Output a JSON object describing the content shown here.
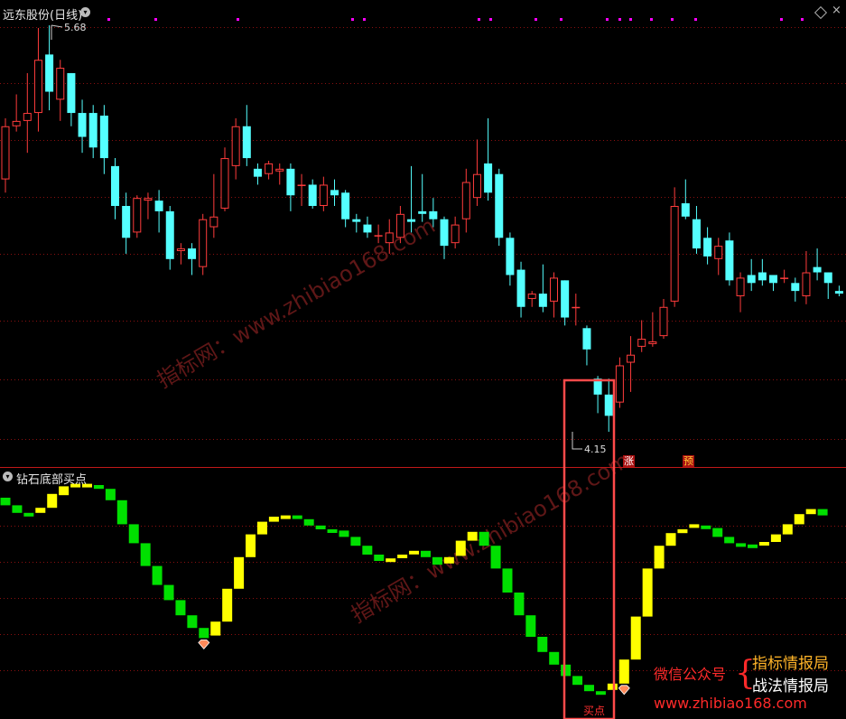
{
  "main_panel": {
    "title": "远东股份(日线)",
    "high_label": "5.68",
    "low_label": "4.15",
    "badge_zhang": "涨",
    "badge_yu": "预"
  },
  "sub_panel": {
    "title": "钻石底部买点",
    "buy_point": "买点"
  },
  "watermark": {
    "site": "指标网：www.zhibiao168.com",
    "site_2": "指标网：www.zhibiao168.com"
  },
  "promo": {
    "wechat": "微信公众号",
    "line1": "指标情报局",
    "line2": "战法情报局",
    "url": "www.zhibiao168.com"
  },
  "colors": {
    "up": "#ff3c3c",
    "down": "#54ffff",
    "grid": "#8a1010",
    "indicator_up": "#ffff00",
    "indicator_down": "#00e000",
    "highlight_box": "#ff4a4a",
    "dots": "#ff00ff"
  },
  "chart_data": [
    {
      "type": "candlestick",
      "name": "远东股份(日线)",
      "ylim": [
        4.1,
        5.75
      ],
      "candles": [
        [
          5.1,
          5.3,
          5.05,
          5.33
        ],
        [
          5.3,
          5.32,
          5.28,
          5.42
        ],
        [
          5.32,
          5.35,
          5.2,
          5.5
        ],
        [
          5.35,
          5.55,
          5.28,
          5.67
        ],
        [
          5.57,
          5.43,
          5.36,
          5.68
        ],
        [
          5.4,
          5.52,
          5.32,
          5.55
        ],
        [
          5.5,
          5.35,
          5.3,
          5.5
        ],
        [
          5.35,
          5.26,
          5.2,
          5.4
        ],
        [
          5.35,
          5.22,
          5.18,
          5.38
        ],
        [
          5.34,
          5.18,
          5.12,
          5.38
        ],
        [
          5.15,
          5.0,
          4.95,
          5.18
        ],
        [
          5.0,
          4.88,
          4.82,
          5.05
        ],
        [
          4.9,
          5.03,
          4.88,
          5.04
        ],
        [
          5.02,
          5.03,
          4.95,
          5.05
        ],
        [
          5.02,
          4.98,
          4.9,
          5.06
        ],
        [
          4.98,
          4.8,
          4.76,
          5.0
        ],
        [
          4.83,
          4.84,
          4.78,
          4.86
        ],
        [
          4.84,
          4.8,
          4.74,
          4.86
        ],
        [
          4.77,
          4.95,
          4.74,
          4.97
        ],
        [
          4.92,
          4.96,
          4.88,
          5.12
        ],
        [
          4.99,
          5.18,
          4.98,
          5.22
        ],
        [
          5.15,
          5.3,
          5.1,
          5.33
        ],
        [
          5.3,
          5.18,
          5.15,
          5.38
        ],
        [
          5.14,
          5.11,
          5.08,
          5.16
        ],
        [
          5.12,
          5.16,
          5.1,
          5.17
        ],
        [
          5.13,
          5.14,
          5.08,
          5.16
        ],
        [
          5.14,
          5.04,
          4.98,
          5.16
        ],
        [
          5.08,
          5.08,
          5.0,
          5.12
        ],
        [
          5.08,
          5.0,
          4.99,
          5.1
        ],
        [
          5.0,
          5.08,
          4.98,
          5.11
        ],
        [
          5.06,
          5.04,
          5.0,
          5.1
        ],
        [
          5.05,
          4.95,
          4.92,
          5.06
        ],
        [
          4.95,
          4.94,
          4.9,
          4.97
        ],
        [
          4.93,
          4.9,
          4.88,
          4.96
        ],
        [
          4.89,
          4.89,
          4.86,
          4.93
        ],
        [
          4.86,
          4.9,
          4.82,
          4.95
        ],
        [
          4.88,
          4.97,
          4.86,
          5.0
        ],
        [
          4.95,
          4.94,
          4.9,
          5.15
        ],
        [
          4.98,
          4.97,
          4.94,
          5.12
        ],
        [
          4.98,
          4.95,
          4.92,
          5.03
        ],
        [
          4.95,
          4.85,
          4.8,
          4.96
        ],
        [
          4.86,
          4.93,
          4.84,
          4.96
        ],
        [
          4.95,
          5.09,
          4.9,
          5.14
        ],
        [
          5.03,
          5.12,
          5.0,
          5.25
        ],
        [
          5.16,
          5.05,
          5.02,
          5.33
        ],
        [
          5.12,
          4.88,
          4.85,
          5.14
        ],
        [
          4.88,
          4.74,
          4.7,
          4.9
        ],
        [
          4.76,
          4.62,
          4.58,
          4.79
        ],
        [
          4.65,
          4.67,
          4.62,
          4.68
        ],
        [
          4.67,
          4.62,
          4.6,
          4.78
        ],
        [
          4.64,
          4.73,
          4.58,
          4.75
        ],
        [
          4.72,
          4.58,
          4.55,
          4.72
        ],
        [
          4.62,
          4.62,
          4.55,
          4.67
        ],
        [
          4.54,
          4.46,
          4.4,
          4.55
        ],
        [
          4.35,
          4.29,
          4.22,
          4.36
        ],
        [
          4.29,
          4.21,
          4.15,
          4.35
        ],
        [
          4.26,
          4.4,
          4.24,
          4.43
        ],
        [
          4.41,
          4.44,
          4.3,
          4.51
        ],
        [
          4.47,
          4.5,
          4.45,
          4.57
        ],
        [
          4.48,
          4.49,
          4.47,
          4.6
        ],
        [
          4.51,
          4.62,
          4.5,
          4.65
        ],
        [
          4.64,
          5.0,
          4.62,
          5.07
        ],
        [
          5.01,
          4.96,
          4.95,
          5.1
        ],
        [
          4.95,
          4.84,
          4.82,
          5.0
        ],
        [
          4.88,
          4.81,
          4.78,
          4.92
        ],
        [
          4.8,
          4.85,
          4.74,
          4.88
        ],
        [
          4.87,
          4.72,
          4.7,
          4.9
        ],
        [
          4.66,
          4.73,
          4.6,
          4.75
        ],
        [
          4.74,
          4.71,
          4.68,
          4.8
        ],
        [
          4.75,
          4.72,
          4.7,
          4.8
        ],
        [
          4.74,
          4.71,
          4.68,
          4.73
        ],
        [
          4.73,
          4.73,
          4.71,
          4.76
        ],
        [
          4.71,
          4.68,
          4.64,
          4.73
        ],
        [
          4.66,
          4.75,
          4.63,
          4.83
        ],
        [
          4.77,
          4.75,
          4.72,
          4.84
        ],
        [
          4.75,
          4.71,
          4.65,
          4.75
        ],
        [
          4.68,
          4.67,
          4.66,
          4.7
        ],
        [
          4.69,
          4.6,
          4.56,
          4.69
        ]
      ]
    },
    {
      "type": "bar",
      "name": "钻石底部买点",
      "ylim": [
        0,
        100
      ],
      "markers": [
        17,
        53
      ],
      "segments": [
        [
          80,
          74,
          0
        ],
        [
          74,
          68,
          0
        ],
        [
          68,
          67,
          0
        ],
        [
          68,
          72,
          1
        ],
        [
          72,
          83,
          1
        ],
        [
          82,
          89,
          1
        ],
        [
          89,
          91,
          1
        ],
        [
          91,
          91,
          1
        ],
        [
          90,
          87,
          0
        ],
        [
          87,
          78,
          0
        ],
        [
          78,
          59,
          0
        ],
        [
          59,
          44,
          0
        ],
        [
          44,
          26,
          0
        ],
        [
          26,
          11,
          0
        ],
        [
          11,
          -1,
          0
        ],
        [
          -1,
          -13,
          0
        ],
        [
          -13,
          -23,
          0
        ],
        [
          -23,
          -31,
          0
        ],
        [
          -29,
          -18,
          1
        ],
        [
          -18,
          8,
          1
        ],
        [
          8,
          33,
          1
        ],
        [
          33,
          51,
          1
        ],
        [
          51,
          61,
          1
        ],
        [
          61,
          65,
          1
        ],
        [
          65,
          66,
          1
        ],
        [
          66,
          64,
          0
        ],
        [
          63,
          58,
          0
        ],
        [
          58,
          55,
          0
        ],
        [
          55,
          54,
          0
        ],
        [
          54,
          49,
          0
        ],
        [
          49,
          42,
          0
        ],
        [
          42,
          35,
          0
        ],
        [
          35,
          30,
          0
        ],
        [
          31,
          32,
          1
        ],
        [
          33,
          35,
          1
        ],
        [
          36,
          38,
          1
        ],
        [
          38,
          33,
          0
        ],
        [
          33,
          27,
          0
        ],
        [
          28,
          33,
          1
        ],
        [
          34,
          46,
          1
        ],
        [
          46,
          53,
          1
        ],
        [
          53,
          42,
          0
        ],
        [
          42,
          24,
          0
        ],
        [
          24,
          5,
          0
        ],
        [
          5,
          -13,
          0
        ],
        [
          -13,
          -30,
          0
        ],
        [
          -30,
          -42,
          0
        ],
        [
          -42,
          -52,
          0
        ],
        [
          -52,
          -61,
          0
        ],
        [
          -61,
          -68,
          0
        ],
        [
          -68,
          -73,
          0
        ],
        [
          -73,
          -75,
          0
        ],
        [
          -72,
          -67,
          1
        ],
        [
          -67,
          -48,
          1
        ],
        [
          -48,
          -14,
          1
        ],
        [
          -14,
          24,
          1
        ],
        [
          24,
          42,
          1
        ],
        [
          42,
          52,
          1
        ],
        [
          52,
          55,
          1
        ],
        [
          57,
          59,
          1
        ],
        [
          58,
          56,
          0
        ],
        [
          56,
          49,
          0
        ],
        [
          49,
          44,
          0
        ],
        [
          44,
          43,
          0
        ],
        [
          43,
          43,
          0
        ],
        [
          44,
          45,
          1
        ],
        [
          45,
          51,
          1
        ],
        [
          51,
          59,
          1
        ],
        [
          59,
          67,
          1
        ],
        [
          67,
          71,
          1
        ],
        [
          71,
          66,
          0
        ]
      ]
    }
  ]
}
